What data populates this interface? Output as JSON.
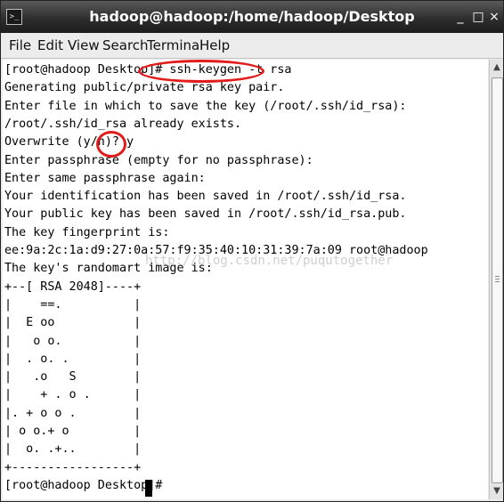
{
  "window": {
    "title": "hadoop@hadoop:/home/hadoop/Desktop",
    "app_icon": "terminal-icon",
    "controls": {
      "minimize": "_",
      "maximize": "□",
      "close": "×"
    }
  },
  "menu": [
    "File",
    "Edit",
    "View",
    "Search",
    "Terminal",
    "Help"
  ],
  "terminal": {
    "lines": [
      "[root@hadoop Desktop]# ssh-keygen -t rsa",
      "Generating public/private rsa key pair.",
      "Enter file in which to save the key (/root/.ssh/id_rsa):",
      "/root/.ssh/id_rsa already exists.",
      "Overwrite (y/n)? y",
      "Enter passphrase (empty for no passphrase):",
      "Enter same passphrase again:",
      "Your identification has been saved in /root/.ssh/id_rsa.",
      "Your public key has been saved in /root/.ssh/id_rsa.pub.",
      "The key fingerprint is:",
      "ee:9a:2c:1a:d9:27:0a:57:f9:35:40:10:31:39:7a:09 root@hadoop",
      "The key's randomart image is:",
      "+--[ RSA 2048]----+",
      "|    ==.          |",
      "|  E oo           |",
      "|   o o.          |",
      "|  . o. .         |",
      "|   .o   S        |",
      "|    + . o .      |",
      "|. + o o .        |",
      "| o o.+ o         |",
      "|  o. .+..        |",
      "+-----------------+",
      "[root@hadoop Desktop]# "
    ],
    "watermark": "http://blog.csdn.net/puqutogether"
  },
  "colors": {
    "annotation": "#e21b1b",
    "titlebar": "#2e2e2e",
    "terminal_bg": "#ffffff"
  }
}
